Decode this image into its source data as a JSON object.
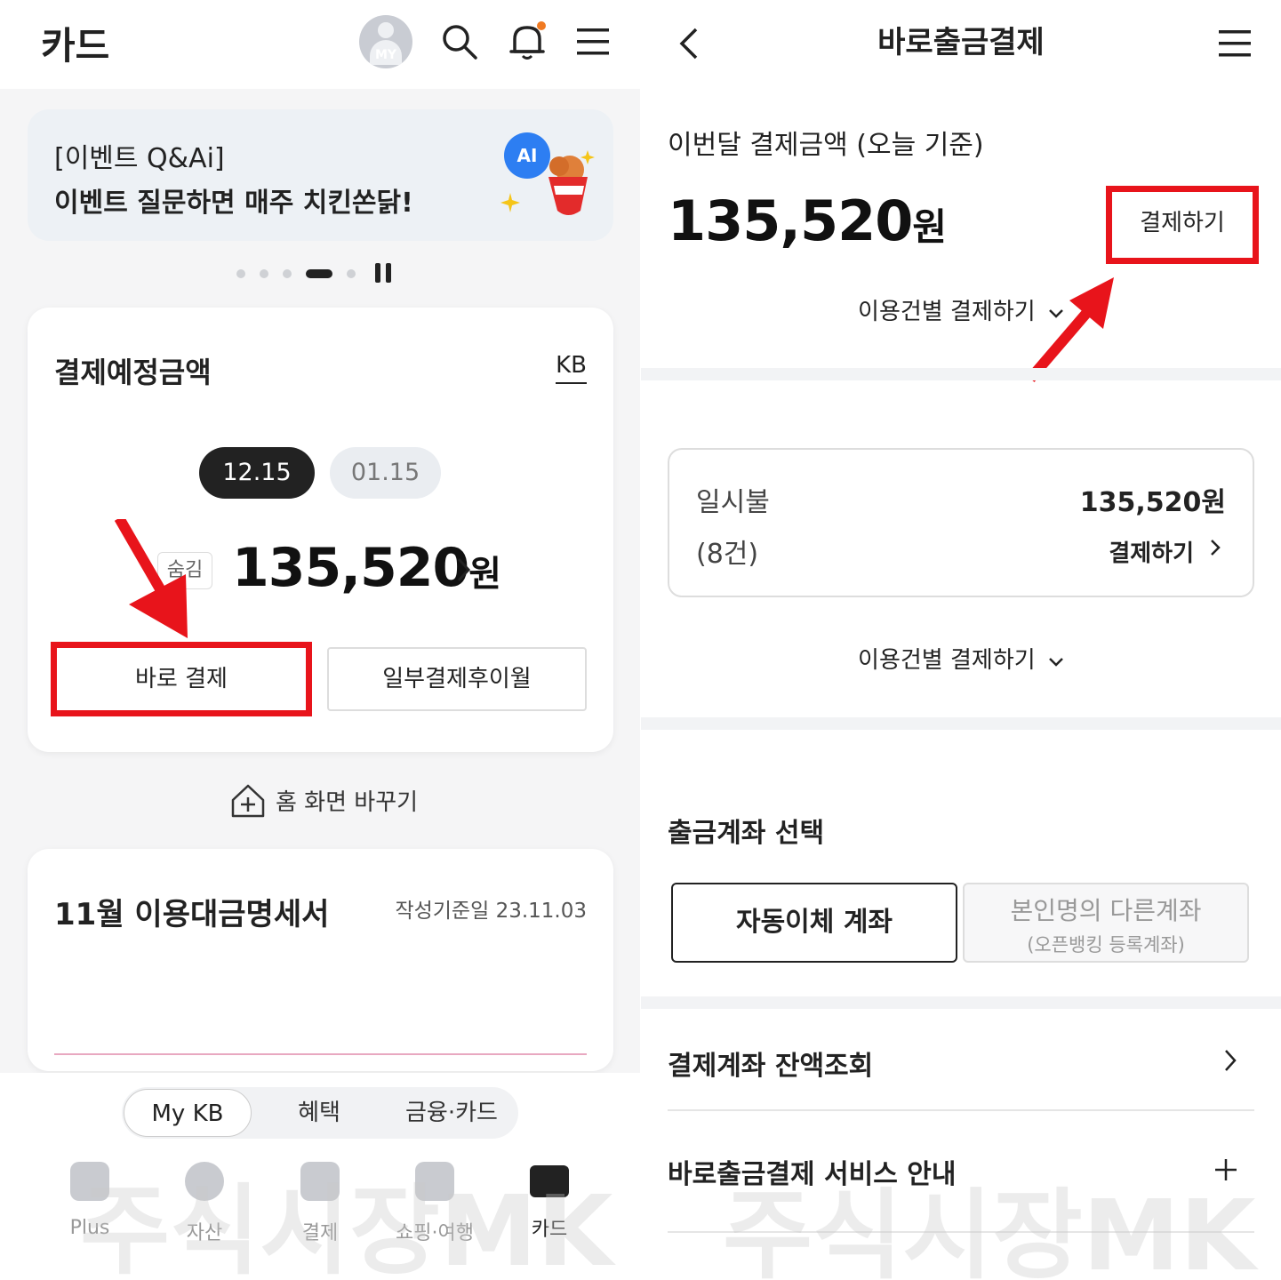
{
  "left": {
    "header": {
      "title": "카드",
      "avatar_label": "MY"
    },
    "banner": {
      "line1": "[이벤트 Q&Ai]",
      "line2": "이벤트 질문하면 매주 치킨쏜닭!",
      "ai_badge": "AI"
    },
    "payment_card": {
      "title": "결제예정금액",
      "card_brand": "KB",
      "dates": [
        "12.15",
        "01.15"
      ],
      "selected_date": "12.15",
      "hide_label": "숨김",
      "amount": "135,520",
      "currency": "원",
      "direct_pay_label": "바로 결제",
      "partial_pay_label": "일부결제후이월"
    },
    "home_change_label": "홈 화면 바꾸기",
    "statement": {
      "title": "11월 이용대금명세서",
      "date": "작성기준일 23.11.03"
    },
    "segment_tabs": [
      "My KB",
      "혜택",
      "금융·카드"
    ],
    "nav": [
      {
        "label": "Plus",
        "icon": "plus-icon"
      },
      {
        "label": "자산",
        "icon": "pie-chart-icon"
      },
      {
        "label": "결제",
        "icon": "scan-icon"
      },
      {
        "label": "쇼핑·여행",
        "icon": "shopping-bag-icon"
      },
      {
        "label": "카드",
        "icon": "card-icon"
      }
    ],
    "watermark": "주식시장MK"
  },
  "right": {
    "header": {
      "title": "바로출금결제"
    },
    "month_label": "이번달 결제금액 (오늘 기준)",
    "amount": "135,520",
    "currency": "원",
    "pay_button": "결제하기",
    "itemize_label": "이용건별 결제하기",
    "lump_sum": {
      "label": "일시불",
      "count": "(8건)",
      "amount": "135,520원",
      "pay_label": "결제하기"
    },
    "account_select": {
      "title": "출금계좌 선택",
      "auto": "자동이체 계좌",
      "other_line1": "본인명의 다른계좌",
      "other_line2": "(오픈뱅킹 등록계좌)"
    },
    "balance_check": "결제계좌 잔액조회",
    "service_info": "바로출금결제 서비스 안내",
    "watermark": "주식시장MK"
  },
  "colors": {
    "highlight": "#e8141b",
    "dark": "#222222",
    "notification": "#f07a22",
    "ai_blue": "#2d7ef2"
  }
}
